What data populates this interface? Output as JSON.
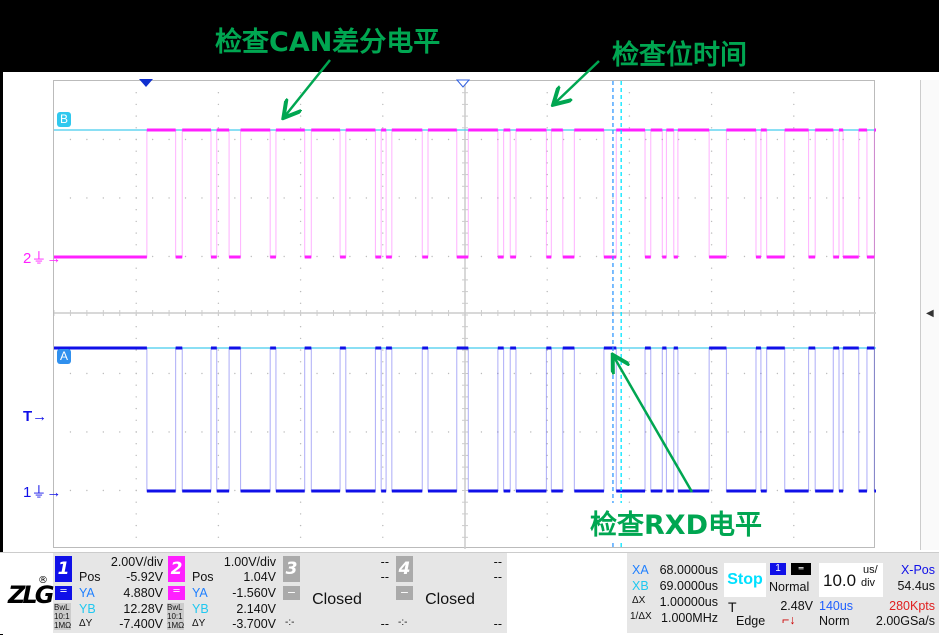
{
  "annotations": {
    "can_level": "检查CAN差分电平",
    "bit_time": "检查位时间",
    "rxd_level": "检查RXD电平"
  },
  "markers": {
    "ref_b": "B",
    "ref_a": "A",
    "ch2": "2",
    "ch1": "1",
    "trigger": "T"
  },
  "colors": {
    "ch1": "#1010e8",
    "ch2": "#ff20ff",
    "cursor_a": "#3399ff",
    "cursor_b": "#00e5ff",
    "ref_line": "#44ccee",
    "annotation": "#00a651"
  },
  "waveform": {
    "time_unit": "us",
    "screen_span_us": [
      0,
      100
    ],
    "ch1_start_edge_us": 11.3,
    "ch1_high_intervals_us": [
      [
        14.8,
        15.6
      ],
      [
        19.1,
        19.8
      ],
      [
        21.3,
        22.7
      ],
      [
        26.3,
        27.0
      ],
      [
        30.5,
        31.3
      ],
      [
        34.8,
        35.5
      ],
      [
        39.1,
        39.8
      ],
      [
        40.4,
        41.1
      ],
      [
        44.8,
        45.5
      ],
      [
        49.0,
        50.4
      ],
      [
        54.0,
        54.7
      ],
      [
        55.5,
        56.2
      ],
      [
        59.9,
        60.5
      ],
      [
        61.9,
        63.3
      ],
      [
        66.9,
        68.4
      ],
      [
        71.9,
        72.6
      ],
      [
        74.0,
        74.5
      ],
      [
        75.4,
        75.9
      ],
      [
        79.7,
        81.8
      ],
      [
        85.4,
        86.0
      ],
      [
        86.7,
        88.9
      ],
      [
        91.8,
        92.6
      ],
      [
        94.8,
        95.5
      ],
      [
        96.0,
        97.9
      ],
      [
        98.9,
        99.8
      ]
    ],
    "cursor_xa_us": 68.0,
    "cursor_xb_us": 69.0
  },
  "ch1": {
    "number": "1",
    "scale": "2.00V/div",
    "pos_label": "Pos",
    "pos": "-5.92V",
    "coupling": "DC",
    "ya_label": "YA",
    "ya": "4.880V",
    "yb_label": "YB",
    "yb": "12.28V",
    "dy_label": "ΔY",
    "dy": "-7.400V",
    "bwl": "BwL",
    "probe": "10:1",
    "imp": "1MΩ"
  },
  "ch2": {
    "number": "2",
    "scale": "1.00V/div",
    "pos_label": "Pos",
    "pos": "1.04V",
    "coupling": "DC",
    "ya_label": "YA",
    "ya": "-1.560V",
    "yb_label": "YB",
    "yb": "2.140V",
    "dy_label": "ΔY",
    "dy": "-3.700V",
    "bwl": "BwL",
    "probe": "10:1",
    "imp": "1MΩ"
  },
  "ch3": {
    "number": "3",
    "top": "--",
    "mid": "--",
    "minus": "−",
    "status": "Closed",
    "bl": "-:-",
    "br": "--"
  },
  "ch4": {
    "number": "4",
    "top": "--",
    "mid": "--",
    "minus": "−",
    "status": "Closed",
    "bl": "-:-",
    "br": "--"
  },
  "cursors": {
    "xa_label": "XA",
    "xa": "68.0000us",
    "xb_label": "XB",
    "xb": "69.0000us",
    "dx_label": "ΔX",
    "dx": "1.00000us",
    "inv_label": "1/ΔX",
    "inv": "1.000MHz"
  },
  "trigger": {
    "state": "Stop",
    "source": "1",
    "mode": "Normal",
    "t_label": "T",
    "level": "2.48V",
    "type": "Edge"
  },
  "timebase": {
    "value": "10.0",
    "unit_top": "us/",
    "unit_bot": "div",
    "xpos_label": "X-Pos",
    "xpos": "54.4us",
    "delay": "140us",
    "points": "280Kpts",
    "acq": "Norm",
    "rate": "2.00GSa/s"
  }
}
